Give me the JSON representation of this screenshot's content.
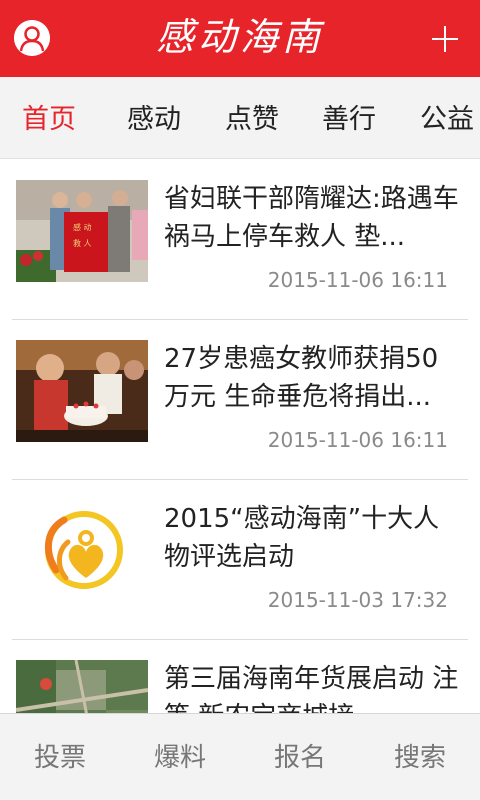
{
  "header": {
    "title": "感动海南",
    "user_icon": "user-avatar-icon",
    "add_icon": "plus-icon",
    "color": "#e8242b"
  },
  "tabs": [
    {
      "label": "首页",
      "active": true
    },
    {
      "label": "感动",
      "active": false
    },
    {
      "label": "点赞",
      "active": false
    },
    {
      "label": "善行",
      "active": false
    },
    {
      "label": "公益",
      "active": false
    }
  ],
  "news": [
    {
      "title": "省妇联干部隋耀达:路遇车祸马上停车救人 垫...",
      "date": "2015-11-06 16:11",
      "thumb": "photo-banner-ceremony"
    },
    {
      "title": "27岁患癌女教师获捐50万元 生命垂危将捐出...",
      "date": "2015-11-06 16:11",
      "thumb": "photo-birthday-cake"
    },
    {
      "title": "2015“感动海南”十大人物评选启动",
      "date": "2015-11-03 17:32",
      "thumb": "logo-heart-emblem"
    },
    {
      "title": "第三届海南年货展启动 注等 新农宝商城接…",
      "date": "",
      "thumb": "photo-aerial-map"
    }
  ],
  "bottom_nav": [
    {
      "label": "投票"
    },
    {
      "label": "爆料"
    },
    {
      "label": "报名"
    },
    {
      "label": "搜索"
    }
  ]
}
